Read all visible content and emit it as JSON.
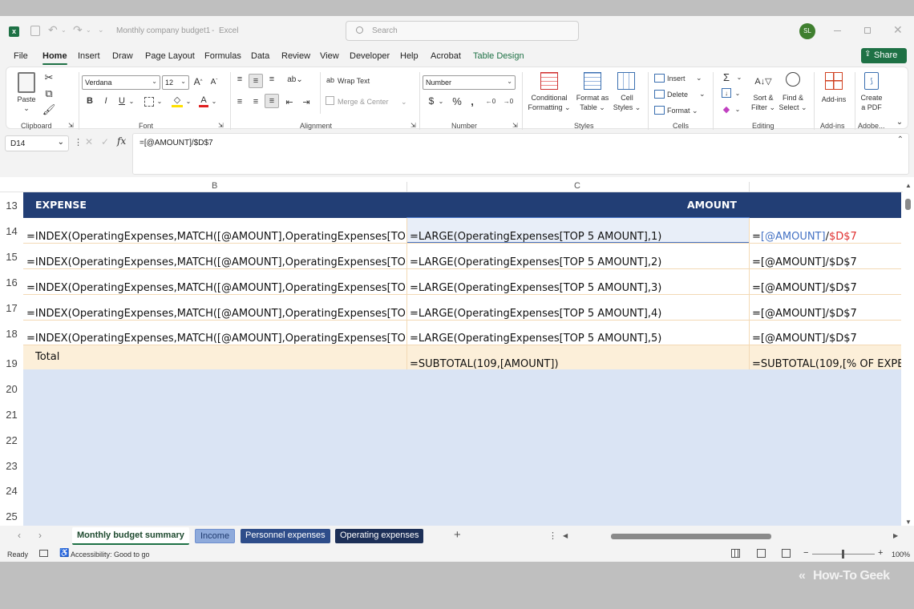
{
  "window": {
    "title": "Monthly company budget1",
    "app": "Excel",
    "search_placeholder": "Search",
    "user_initials": "SL"
  },
  "menu": [
    "File",
    "Home",
    "Insert",
    "Draw",
    "Page Layout",
    "Formulas",
    "Data",
    "Review",
    "View",
    "Developer",
    "Help",
    "Acrobat",
    "Table Design"
  ],
  "share_label": "Share",
  "ribbon": {
    "paste": "Paste",
    "clipboard": "Clipboard",
    "font_name": "Verdana",
    "font_size": "12",
    "font_group": "Font",
    "wrap_text": "Wrap Text",
    "merge_center": "Merge & Center",
    "alignment": "Alignment",
    "number_format": "Number",
    "number_group": "Number",
    "conditional": [
      "Conditional",
      "Formatting"
    ],
    "format_as": [
      "Format as",
      "Table"
    ],
    "cell_styles": [
      "Cell",
      "Styles"
    ],
    "styles_group": "Styles",
    "insert": "Insert",
    "delete": "Delete",
    "format": "Format",
    "cells_group": "Cells",
    "sort": [
      "Sort &",
      "Filter"
    ],
    "find": [
      "Find &",
      "Select"
    ],
    "editing_group": "Editing",
    "addins": "Add-ins",
    "addins_group": "Add-ins",
    "create_pdf": [
      "Create",
      "a PDF"
    ],
    "adobe_group": "Adobe..."
  },
  "formula_bar": {
    "name_box": "D14",
    "formula": "=[@AMOUNT]/$D$7"
  },
  "columns": [
    "B",
    "C"
  ],
  "header": {
    "expense": "EXPENSE",
    "amount": "AMOUNT"
  },
  "rows": [
    {
      "num": "13"
    },
    {
      "num": "14",
      "b": "=INDEX(OperatingExpenses,MATCH([@AMOUNT],OperatingExpenses[TOP",
      "c": "=LARGE(OperatingExpenses[TOP 5 AMOUNT],1)",
      "d_pre": "=",
      "d_ref": "[@AMOUNT]",
      "d_slash": "/",
      "d_abs": "$D$7"
    },
    {
      "num": "15",
      "b": "=INDEX(OperatingExpenses,MATCH([@AMOUNT],OperatingExpenses[TOP",
      "c": "=LARGE(OperatingExpenses[TOP 5 AMOUNT],2)",
      "d": "=[@AMOUNT]/$D$7"
    },
    {
      "num": "16",
      "b": "=INDEX(OperatingExpenses,MATCH([@AMOUNT],OperatingExpenses[TOP",
      "c": "=LARGE(OperatingExpenses[TOP 5 AMOUNT],3)",
      "d": "=[@AMOUNT]/$D$7"
    },
    {
      "num": "17",
      "b": "=INDEX(OperatingExpenses,MATCH([@AMOUNT],OperatingExpenses[TOP",
      "c": "=LARGE(OperatingExpenses[TOP 5 AMOUNT],4)",
      "d": "=[@AMOUNT]/$D$7"
    },
    {
      "num": "18",
      "b": "=INDEX(OperatingExpenses,MATCH([@AMOUNT],OperatingExpenses[TOP",
      "c": "=LARGE(OperatingExpenses[TOP 5 AMOUNT],5)",
      "d": "=[@AMOUNT]/$D$7"
    },
    {
      "num": "19",
      "b": "Total",
      "c": "=SUBTOTAL(109,[AMOUNT])",
      "d": "=SUBTOTAL(109,[% OF EXPE"
    },
    {
      "num": "20"
    },
    {
      "num": "21"
    },
    {
      "num": "22"
    },
    {
      "num": "23"
    },
    {
      "num": "24"
    },
    {
      "num": "25"
    }
  ],
  "sheets": [
    "Monthly budget summary",
    "Income",
    "Personnel expenses",
    "Operating expenses"
  ],
  "status": {
    "ready": "Ready",
    "accessibility": "Accessibility: Good to go",
    "zoom": "100%"
  },
  "watermark": "How-To Geek",
  "colors": {
    "excel_green": "#1e7145",
    "table_header": "#223e75",
    "total_row": "#fcefd9",
    "empty_area": "#dae4f4",
    "ref_blue": "#4472c4",
    "ref_red": "#e03030"
  }
}
